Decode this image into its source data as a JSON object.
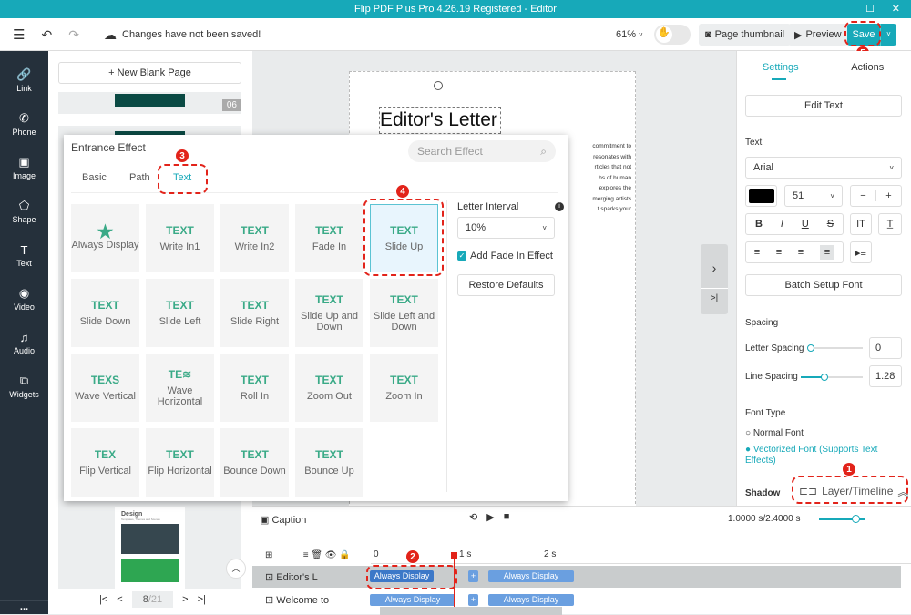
{
  "window": {
    "title": "Flip PDF Plus Pro 4.26.19 Registered - Editor"
  },
  "toolbar": {
    "status": "Changes have not been saved!",
    "zoom": "61%",
    "page_thumbnail": "Page thumbnail",
    "preview": "Preview",
    "save": "Save"
  },
  "sidebar": {
    "items": [
      {
        "label": "Link",
        "icon": "link-icon"
      },
      {
        "label": "Phone",
        "icon": "phone-icon"
      },
      {
        "label": "Image",
        "icon": "image-icon"
      },
      {
        "label": "Shape",
        "icon": "shape-icon"
      },
      {
        "label": "Text",
        "icon": "text-icon"
      },
      {
        "label": "Video",
        "icon": "video-icon"
      },
      {
        "label": "Audio",
        "icon": "audio-icon"
      },
      {
        "label": "Widgets",
        "icon": "widgets-icon"
      }
    ],
    "more": "..."
  },
  "pages": {
    "new_blank": "+ New Blank Page",
    "page_badge": "06",
    "thumb_title": "Design",
    "thumb_subtitle": "Templates, Themes and Scenes",
    "pager": {
      "current": "8",
      "total": "/21"
    }
  },
  "canvas": {
    "heading": "Editor's Letter",
    "body_lines": [
      "commitment to",
      "resonates with",
      "rticles that not",
      "hs of human",
      "explores the",
      "merging artists",
      "t sparks your"
    ]
  },
  "popup": {
    "title": "Entrance Effect",
    "search_placeholder": "Search Effect",
    "tabs": [
      "Basic",
      "Path",
      "Text"
    ],
    "active_tab": "Text",
    "effects": [
      {
        "label": "Always Display",
        "icon": "★"
      },
      {
        "label": "Write In1",
        "icon": "TEXT"
      },
      {
        "label": "Write In2",
        "icon": "TEXT"
      },
      {
        "label": "Fade In",
        "icon": "TEXT"
      },
      {
        "label": "Slide Up",
        "icon": "TEXT"
      },
      {
        "label": "Slide Down",
        "icon": "TEXT"
      },
      {
        "label": "Slide Left",
        "icon": "TEXT"
      },
      {
        "label": "Slide Right",
        "icon": "TEXT"
      },
      {
        "label": "Slide Up and Down",
        "icon": "TEXT"
      },
      {
        "label": "Slide Left and Down",
        "icon": "TEXT"
      },
      {
        "label": "Wave Vertical",
        "icon": "TEXS"
      },
      {
        "label": "Wave Horizontal",
        "icon": "TE≋"
      },
      {
        "label": "Roll In",
        "icon": "TEXT"
      },
      {
        "label": "Zoom Out",
        "icon": "TEXT"
      },
      {
        "label": "Zoom In",
        "icon": "TEXT"
      },
      {
        "label": "Flip Vertical",
        "icon": "TEX"
      },
      {
        "label": "Flip Horizontal",
        "icon": "TEXT"
      },
      {
        "label": "Bounce Down",
        "icon": "TEXT"
      },
      {
        "label": "Bounce Up",
        "icon": "TEXT"
      }
    ],
    "selected": "Slide Up",
    "letter_interval_label": "Letter Interval",
    "letter_interval": "10%",
    "fade_label": "Add Fade In Effect",
    "fade_checked": true,
    "restore": "Restore Defaults"
  },
  "right": {
    "tabs": [
      "Settings",
      "Actions"
    ],
    "edit_text": "Edit Text",
    "text_section": "Text",
    "font": "Arial",
    "font_size": "51",
    "font_color": "#000000",
    "batch": "Batch Setup Font",
    "spacing": "Spacing",
    "letter_spacing_label": "Letter Spacing",
    "letter_spacing": "0",
    "line_spacing_label": "Line Spacing",
    "line_spacing": "1.28",
    "font_type": "Font Type",
    "normal_font": "Normal Font",
    "vector_font": "Vectorized Font (Supports Text Effects)",
    "shadow": "Shadow",
    "layer_timeline": "Layer/Timeline"
  },
  "timeline": {
    "caption": "Caption",
    "time": "1.0000 s/2.4000 s",
    "ticks": [
      "0",
      "1 s",
      "2 s"
    ],
    "rows": [
      {
        "name": "Editor's L",
        "effect1": "Always Display",
        "effect2": "Always Display"
      },
      {
        "name": "Welcome to",
        "effect1": "Always Display",
        "effect2": "Always Display"
      }
    ]
  },
  "annotations": [
    "1",
    "2",
    "3",
    "4",
    "5"
  ],
  "colors": {
    "accent": "#17a9b9",
    "annotation": "#e2231a",
    "sidebar": "#25303b",
    "effect_icon": "#3aaa87"
  }
}
